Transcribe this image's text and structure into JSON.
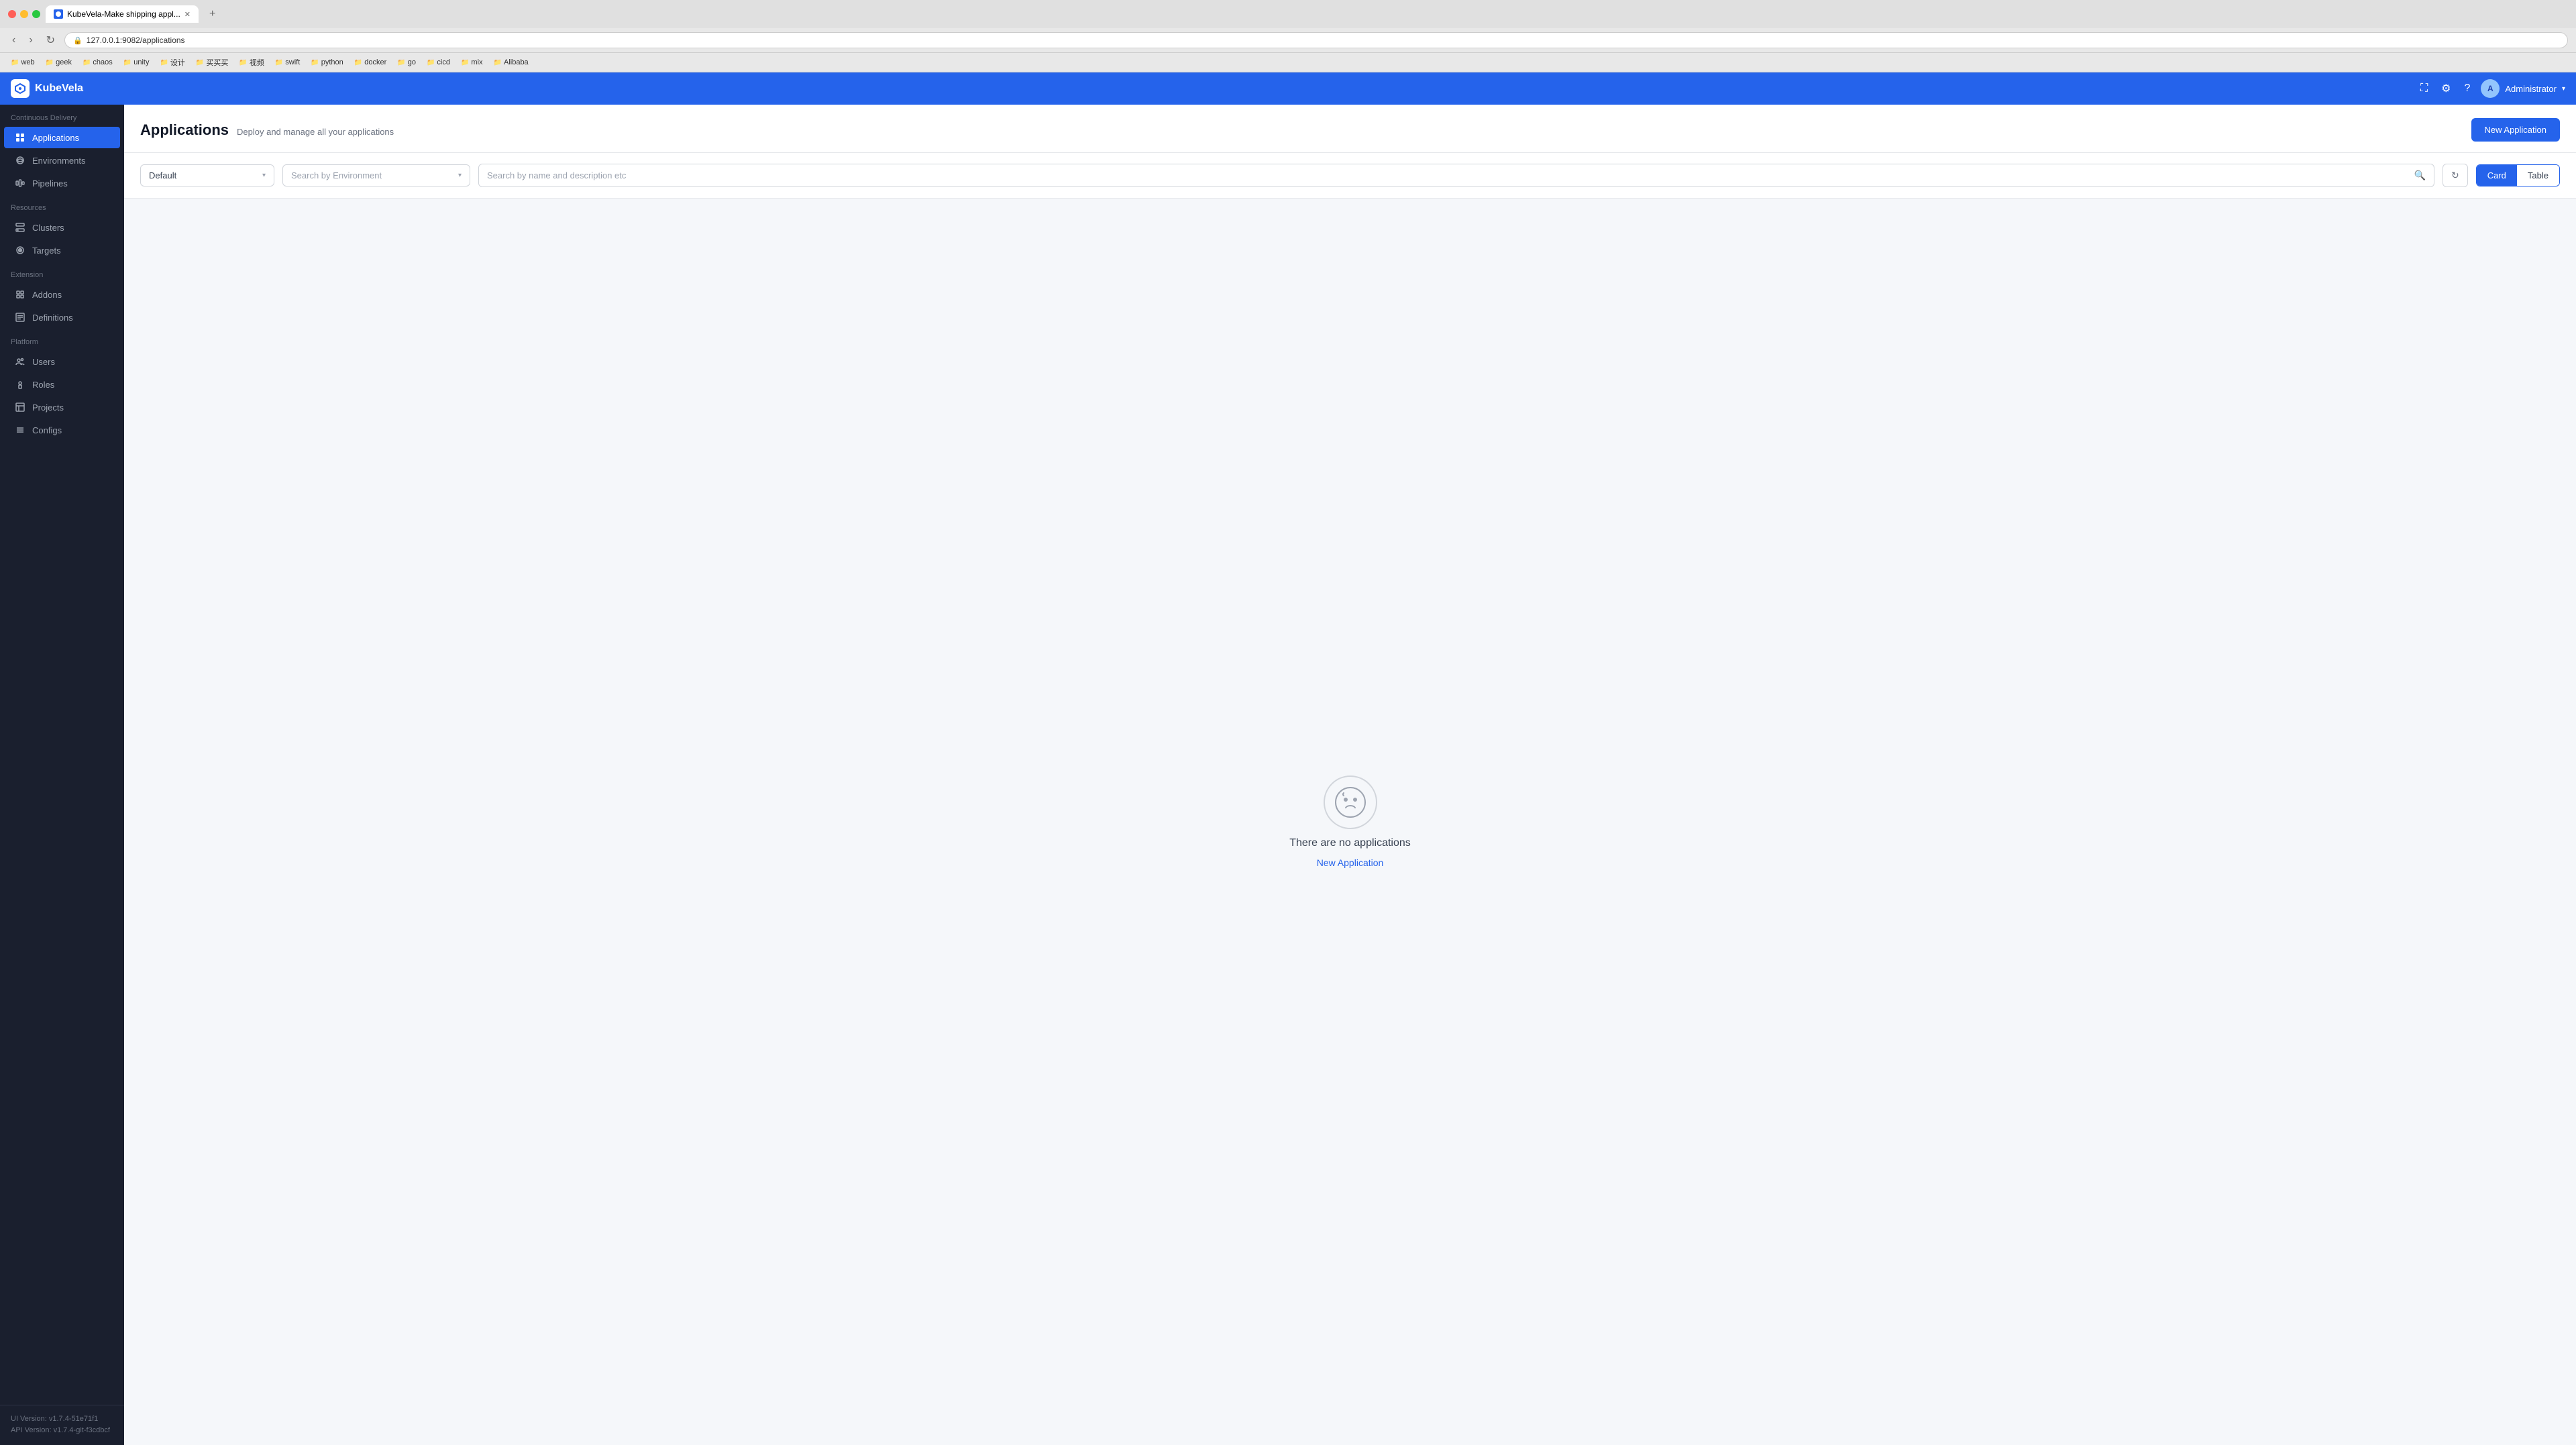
{
  "browser": {
    "tab_title": "KubeVela-Make shipping appl...",
    "url": "127.0.0.1:9082/applications",
    "new_tab_label": "+",
    "back_btn": "‹",
    "forward_btn": "›",
    "refresh_btn": "↻",
    "bookmarks": [
      {
        "label": "web",
        "icon": "📁"
      },
      {
        "label": "geek",
        "icon": "📁"
      },
      {
        "label": "chaos",
        "icon": "📁"
      },
      {
        "label": "unity",
        "icon": "📁"
      },
      {
        "label": "设计",
        "icon": "📁"
      },
      {
        "label": "买买买",
        "icon": "📁"
      },
      {
        "label": "视频",
        "icon": "📁"
      },
      {
        "label": "swift",
        "icon": "📁"
      },
      {
        "label": "python",
        "icon": "📁"
      },
      {
        "label": "docker",
        "icon": "📁"
      },
      {
        "label": "go",
        "icon": "📁"
      },
      {
        "label": "cicd",
        "icon": "📁"
      },
      {
        "label": "mix",
        "icon": "📁"
      },
      {
        "label": "Alibaba",
        "icon": "📁"
      }
    ]
  },
  "topnav": {
    "logo_text": "KubeVela",
    "user_name": "Administrator",
    "user_initials": "A"
  },
  "sidebar": {
    "section_continuous_delivery": "Continuous Delivery",
    "section_resources": "Resources",
    "section_extension": "Extension",
    "section_platform": "Platform",
    "items": {
      "applications": "Applications",
      "environments": "Environments",
      "pipelines": "Pipelines",
      "clusters": "Clusters",
      "targets": "Targets",
      "addons": "Addons",
      "definitions": "Definitions",
      "users": "Users",
      "roles": "Roles",
      "projects": "Projects",
      "configs": "Configs"
    },
    "ui_version": "UI Version: v1.7.4-51e71f1",
    "api_version": "API Version: v1.7.4-git-f3cdbcf"
  },
  "main": {
    "title": "Applications",
    "subtitle": "Deploy and manage all your applications",
    "new_app_btn": "New Application",
    "filter_project_placeholder": "Default",
    "filter_env_placeholder": "Search by Environment",
    "filter_name_placeholder": "Search by name and description etc",
    "view_card": "Card",
    "view_table": "Table",
    "empty_message": "There are no applications",
    "empty_link": "New Application"
  }
}
